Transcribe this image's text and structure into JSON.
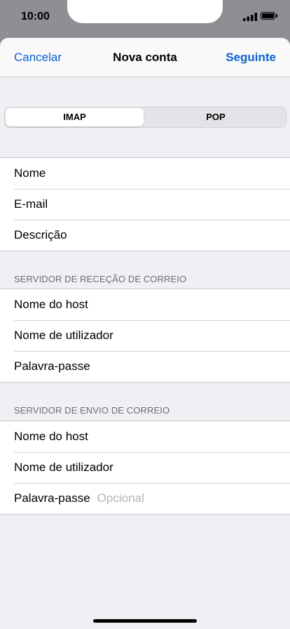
{
  "status_bar": {
    "time": "10:00",
    "icons": [
      "signal-icon",
      "battery-icon"
    ]
  },
  "nav": {
    "cancel": "Cancelar",
    "title": "Nova conta",
    "next": "Seguinte"
  },
  "segments": {
    "items": [
      "IMAP",
      "POP"
    ],
    "selected": "IMAP"
  },
  "account": {
    "rows": [
      "Nome",
      "E-mail",
      "Descrição"
    ]
  },
  "incoming": {
    "header": "SERVIDOR DE RECEÇÃO DE CORREIO",
    "rows": [
      "Nome do host",
      "Nome de utilizador",
      "Palavra-passe"
    ]
  },
  "outgoing": {
    "header": "SERVIDOR DE ENVIO DE CORREIO",
    "rows": [
      "Nome do host",
      "Nome de utilizador",
      "Palavra-passe"
    ],
    "password_placeholder": "Opcional"
  },
  "colors": {
    "accent": "#0b61d2",
    "background": "#efeff4",
    "separator": "#c8c7cc"
  }
}
